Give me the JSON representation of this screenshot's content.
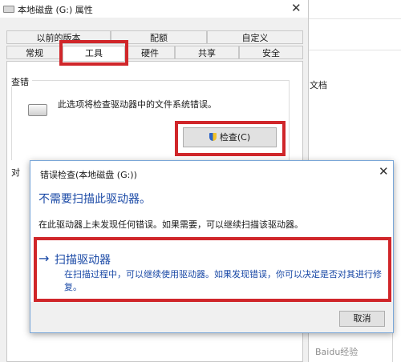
{
  "background": {
    "text": "文档"
  },
  "properties": {
    "title": "本地磁盘 (G:) 属性",
    "tabs_row1": [
      "以前的版本",
      "配额",
      "自定义"
    ],
    "tabs_row2": [
      "常规",
      "工具",
      "硬件",
      "共享",
      "安全"
    ],
    "active_tab": "工具",
    "check_group_label": "查错",
    "check_description": "此选项将检查驱动器中的文件系统错误。",
    "check_button": "检查(C)",
    "second_group_label": "对"
  },
  "dialog": {
    "title": "错误检查(本地磁盘 (G:))",
    "heading": "不需要扫描此驱动器。",
    "subtext": "在此驱动器上未发现任何错误。如果需要，可以继续扫描该驱动器。",
    "scan_option": {
      "arrow": "→",
      "title": "扫描驱动器",
      "description": "在扫描过程中，可以继续使用驱动器。如果发现错误，你可以决定是否对其进行修复。"
    },
    "cancel_button": "取消"
  },
  "watermark": "Baidu经验",
  "colors": {
    "highlight_red": "#d0262a",
    "link_blue": "#1a49a6"
  }
}
